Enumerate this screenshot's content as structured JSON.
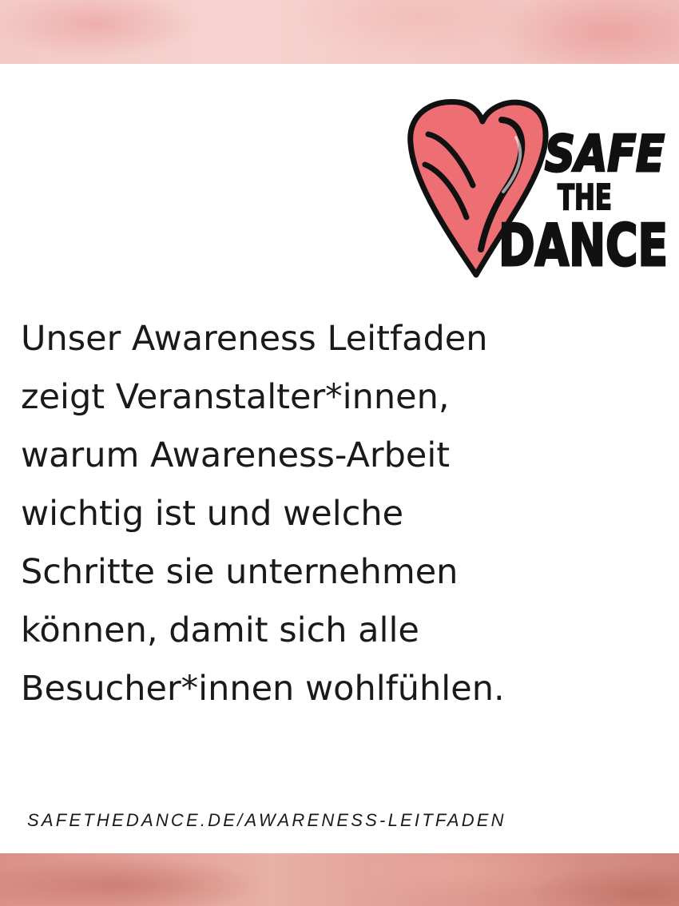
{
  "colors": {
    "heart": "#ee6f73",
    "text": "#1a1a1a",
    "band_top": "#f3c9c4",
    "band_bottom": "#d99088"
  },
  "logo": {
    "icon": "heart-logo-icon",
    "words": [
      "SAFE",
      "THE",
      "DANCE"
    ]
  },
  "main_text": {
    "lines": [
      "Unser Awareness Leitfaden",
      "zeigt Veranstalter*innen,",
      "warum Awareness-Arbeit",
      "wichtig ist und welche",
      "Schritte sie unternehmen",
      "können, damit sich alle",
      "Besucher*innen wohlfühlen."
    ]
  },
  "footer": {
    "url": "SAFETHEDANCE.DE/AWARENESS-LEITFADEN"
  }
}
